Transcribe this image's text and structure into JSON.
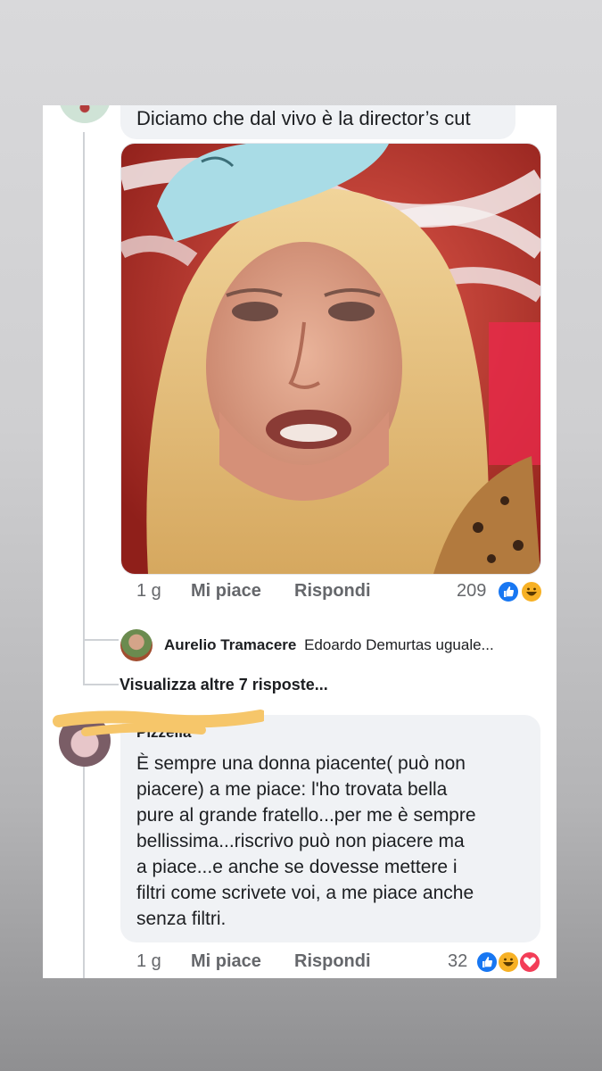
{
  "comment1": {
    "text": "Diciamo che dal vivo è la director’s cut",
    "photo_icon": "woman-portrait-photo",
    "time": "1 g",
    "like_label": "Mi piace",
    "reply_label": "Rispondi",
    "reaction_count": "209",
    "reactions": [
      "like-icon",
      "haha-icon"
    ]
  },
  "reply_preview": {
    "author": "Aurelio Tramacere",
    "text": "Edoardo Demurtas uguale..."
  },
  "view_more": "Visualizza altre 7 risposte...",
  "comment2": {
    "author_visible": "Pizzella",
    "text": "È sempre una donna piacente( può non\npiacere) a me piace: l'ho trovata bella\npure al grande fratello...per me è sempre\nbellissima...riscrivo può non piacere ma\na piace...e anche se dovesse mettere i\nfiltri come scrivete voi, a me piace anche\nsenza filtri.",
    "time": "1 g",
    "like_label": "Mi piace",
    "reply_label": "Rispondi",
    "reaction_count": "32",
    "reactions": [
      "like-icon",
      "haha-icon",
      "love-icon"
    ]
  },
  "colors": {
    "like_blue": "#1877f2",
    "haha_yellow": "#f7b125",
    "love_red": "#f33e58",
    "highlight_scribble": "#f6c66a"
  }
}
